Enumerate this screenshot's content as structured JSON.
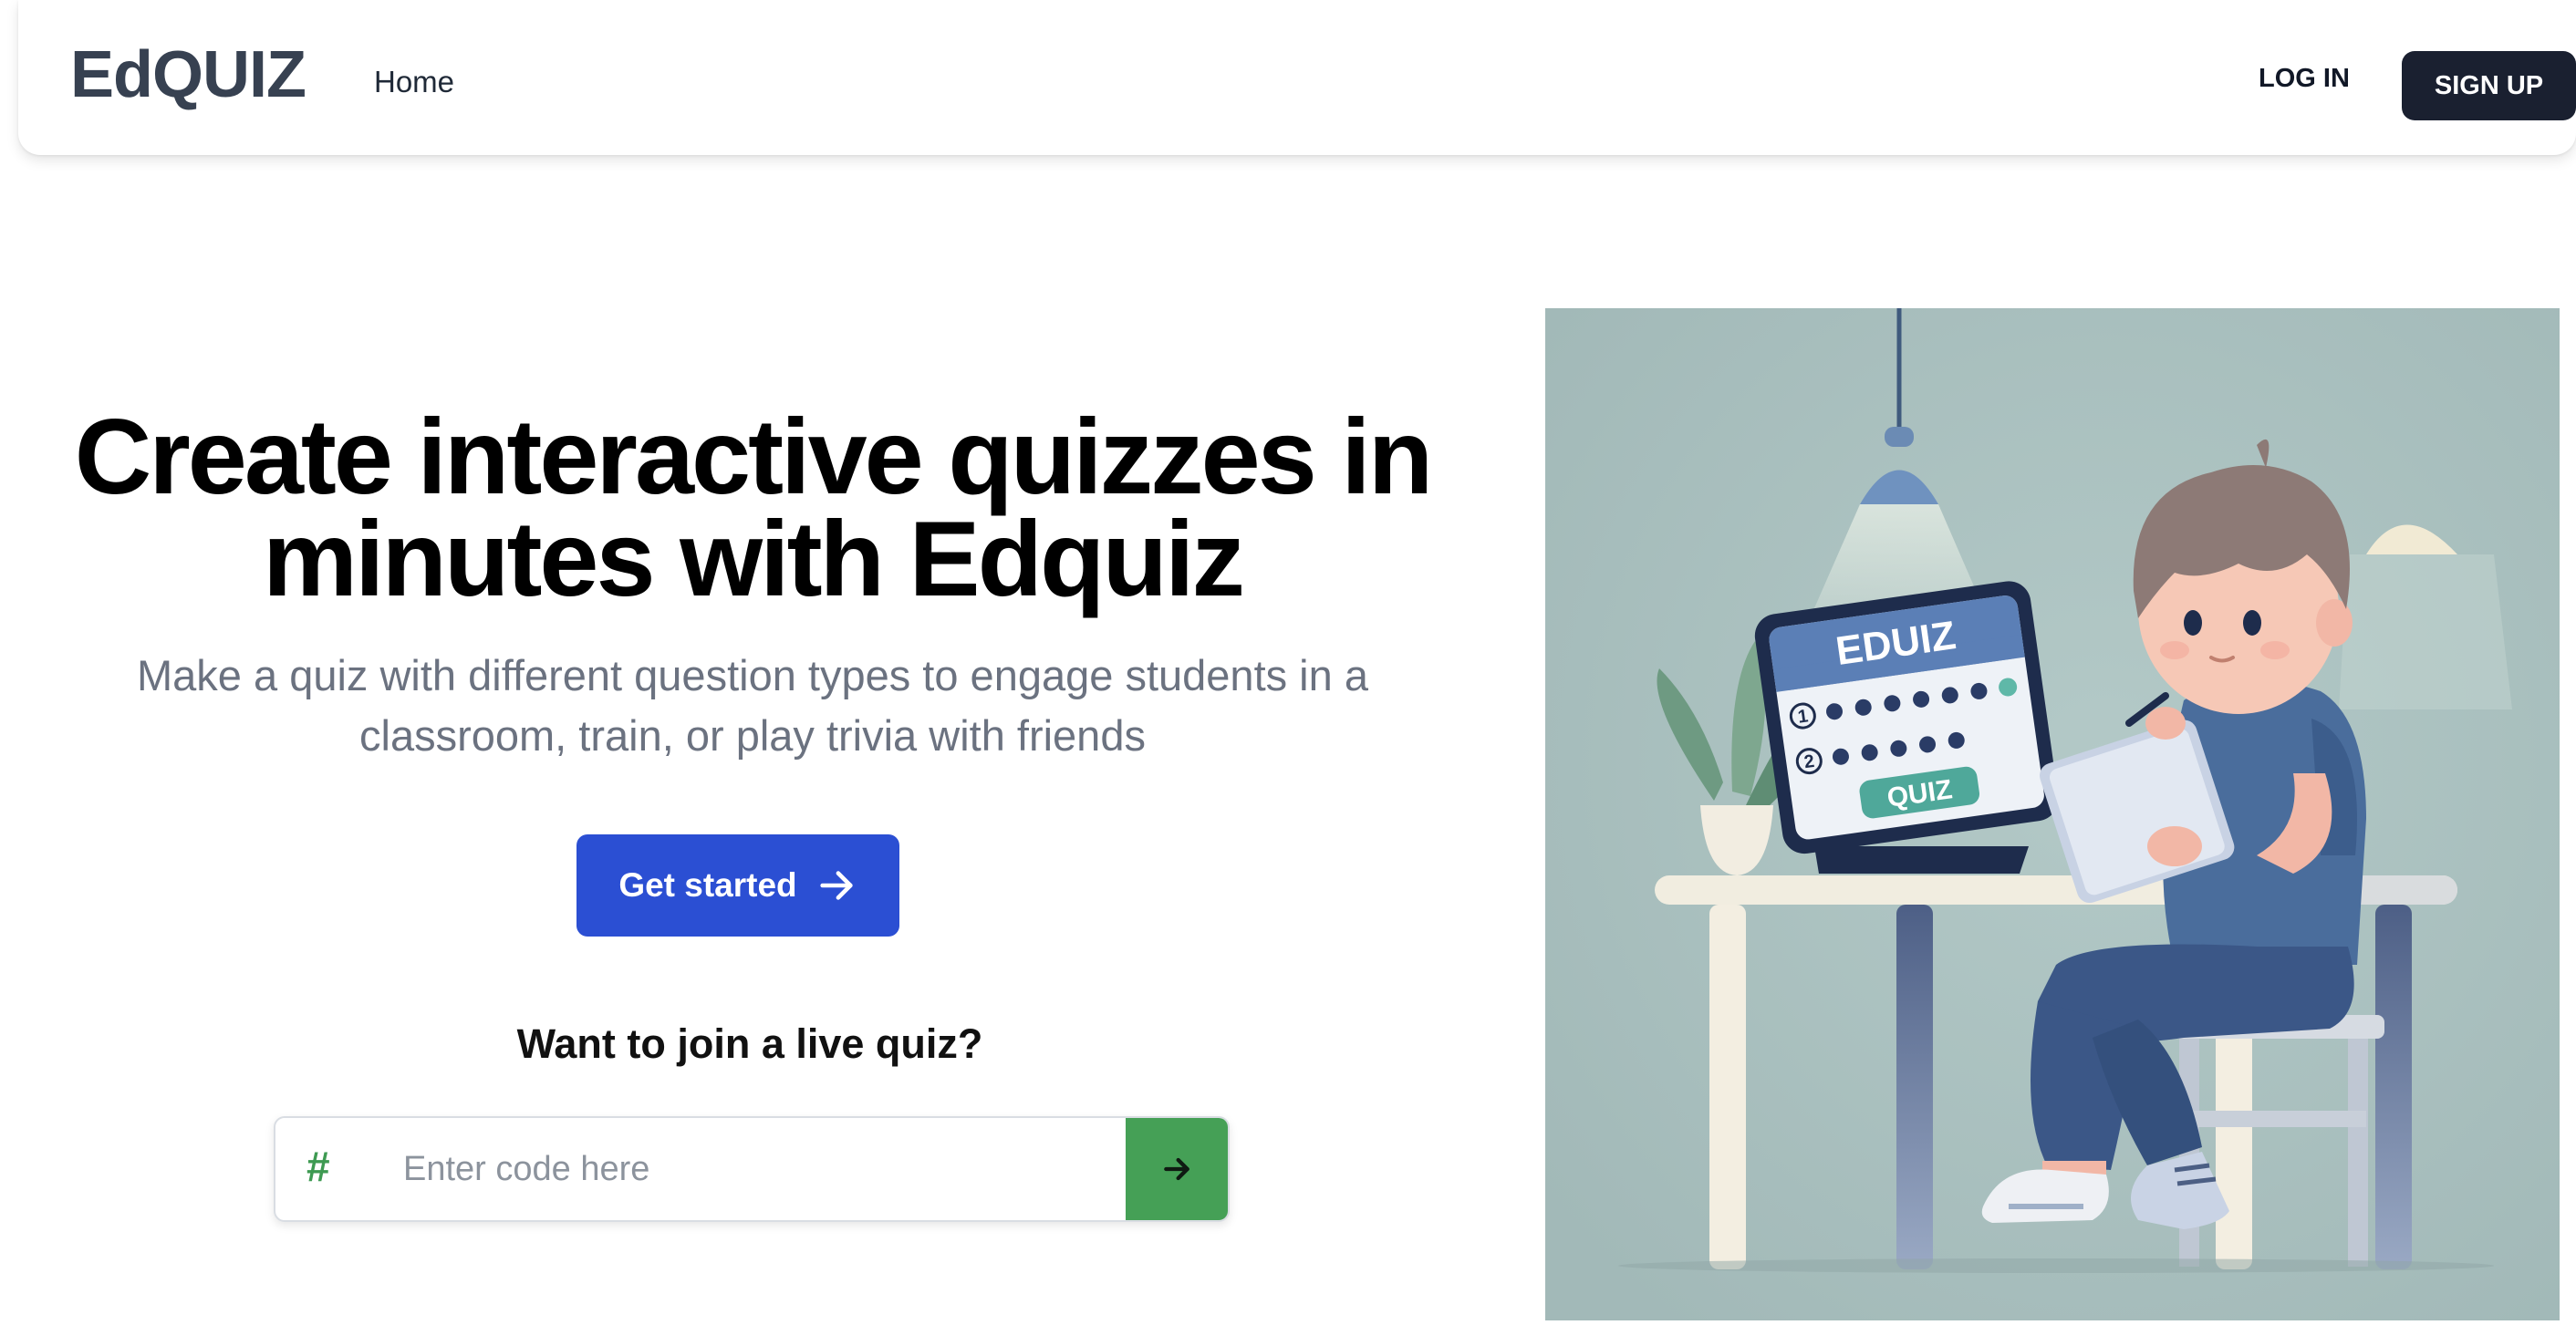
{
  "header": {
    "logo": "EdQUIZ",
    "nav": [
      {
        "label": "Home"
      }
    ],
    "login_label": "LOG IN",
    "signup_label": "SIGN UP"
  },
  "hero": {
    "title_line1": "Create interactive quizzes in",
    "title_line2": "minutes with Edquiz",
    "subtitle_line1": "Make a quiz with different question types to engage students in a",
    "subtitle_line2": "classroom, train, or play trivia with friends",
    "cta_label": "Get started",
    "cta_icon": "arrow-right-icon"
  },
  "join": {
    "title": "Want to join a live quiz?",
    "prefix": "#",
    "placeholder": "Enter code here",
    "value": "",
    "submit_icon": "arrow-right-icon"
  },
  "illustration": {
    "tablet_title": "EDUIZ",
    "tablet_button": "QUIZ",
    "row_numbers": [
      "1",
      "2"
    ]
  },
  "colors": {
    "primary": "#2b4fd3",
    "accent_green": "#45a056",
    "dark": "#1a2030",
    "illustration_bg": "#a9c0bf"
  }
}
